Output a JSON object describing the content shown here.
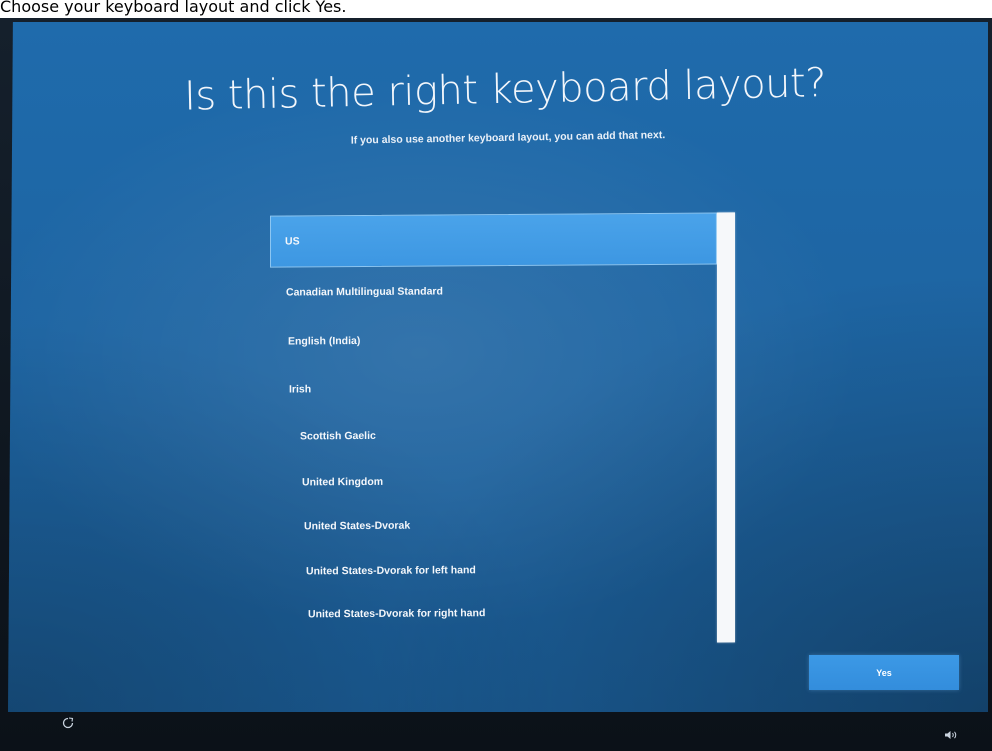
{
  "caption": "Choose your keyboard layout and click Yes.",
  "oobe": {
    "title": "Is this the right keyboard layout?",
    "subtitle": "If you also use another keyboard layout, you can add that next.",
    "layouts": [
      {
        "label": "US",
        "selected": true
      },
      {
        "label": "Canadian Multilingual Standard",
        "selected": false
      },
      {
        "label": "English (India)",
        "selected": false
      },
      {
        "label": "Irish",
        "selected": false
      },
      {
        "label": "Scottish Gaelic",
        "selected": false
      },
      {
        "label": "United Kingdom",
        "selected": false
      },
      {
        "label": "United States-Dvorak",
        "selected": false
      },
      {
        "label": "United States-Dvorak for left hand",
        "selected": false
      },
      {
        "label": "United States-Dvorak for right hand",
        "selected": false
      }
    ],
    "yes_button": "Yes"
  },
  "taskbar": {
    "left_icon": "ease-of-access-icon",
    "right_icon": "volume-icon"
  },
  "colors": {
    "background_blue": "#1f6bac",
    "selected_item": "#4aa3ea",
    "button_blue": "#3c99e6",
    "scrollbar": "#f6f8fa"
  }
}
